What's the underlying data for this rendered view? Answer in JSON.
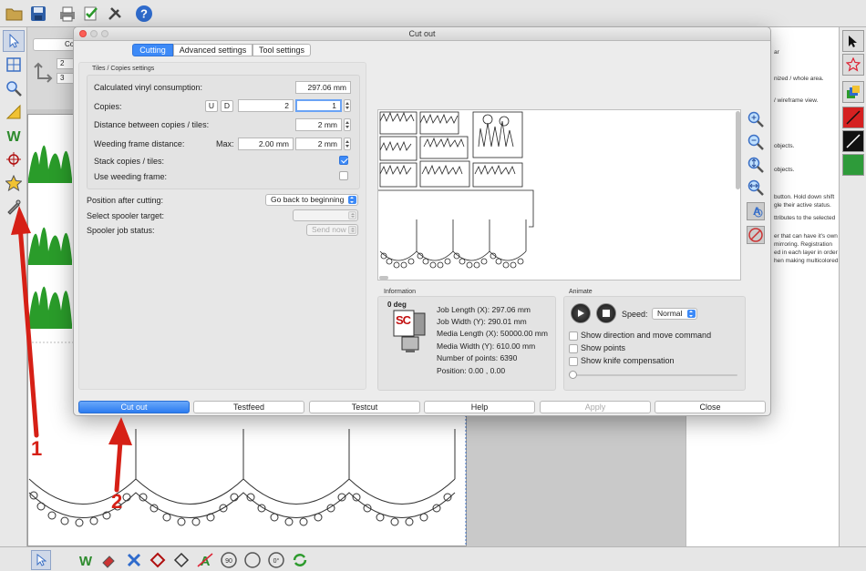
{
  "dialog": {
    "title": "Cut out",
    "tabs": [
      {
        "label": "Cutting",
        "active": true
      },
      {
        "label": "Advanced settings",
        "active": false
      },
      {
        "label": "Tool settings",
        "active": false
      }
    ],
    "tiles_group": {
      "title": "Tiles / Copies settings",
      "calc_vinyl_label": "Calculated vinyl consumption:",
      "calc_vinyl_value": "297.06 mm",
      "copies_label": "Copies:",
      "copies_u": "U",
      "copies_d": "D",
      "copies_value_1": "2",
      "copies_value_2": "1",
      "distance_label": "Distance between copies / tiles:",
      "distance_value": "2 mm",
      "weeding_distance_label": "Weeding frame distance:",
      "weeding_max_label": "Max:",
      "weeding_max_value": "2.00 mm",
      "weeding_value": "2 mm",
      "stack_label": "Stack copies / tiles:",
      "stack_checked": true,
      "use_weeding_label": "Use weeding frame:",
      "use_weeding_checked": false
    },
    "position_after_label": "Position after cutting:",
    "position_after_value": "Go back to beginning",
    "spooler_target_label": "Select spooler target:",
    "spooler_target_value": "",
    "spooler_status_label": "Spooler job status:",
    "spooler_status_value": "Send now",
    "information": {
      "title": "Information",
      "angle": "0 deg",
      "logo_text": "SC",
      "job_length": "Job Length (X): 297.06 mm",
      "job_width": "Job Width (Y): 290.01 mm",
      "media_length": "Media Length (X): 50000.00 mm",
      "media_width": "Media Width (Y): 610.00 mm",
      "points": "Number of points: 6390",
      "position": "Position: 0.00 , 0.00"
    },
    "animate": {
      "title": "Animate",
      "speed_label": "Speed:",
      "speed_value": "Normal",
      "show_direction": "Show direction and move command",
      "show_points": "Show points",
      "show_knife": "Show knife compensation",
      "slider_level": 0
    },
    "buttons": {
      "cut_out": "Cut out",
      "testfeed": "Testfeed",
      "testcut": "Testcut",
      "help": "Help",
      "apply": "Apply",
      "close": "Close"
    }
  },
  "help_panel": {
    "lines": [
      "ar",
      "nized / whole area.",
      "/ wireframe view.",
      "objects.",
      "objects.",
      "button. Hold down shift",
      "gle their active status.",
      "ttributes to the selected",
      "er that can have it's own",
      "mirroring. Registration",
      "ed in each layer in order",
      "hen making multicolored"
    ]
  },
  "background": {
    "coord_fields": [
      "2",
      "3"
    ],
    "stub_button": "Co"
  },
  "annotations": {
    "arrow1_number": "1",
    "arrow2_number": "2",
    "color": "#d62016"
  },
  "colors": {
    "accent": "#3d8af7",
    "annotation": "#d62016"
  }
}
